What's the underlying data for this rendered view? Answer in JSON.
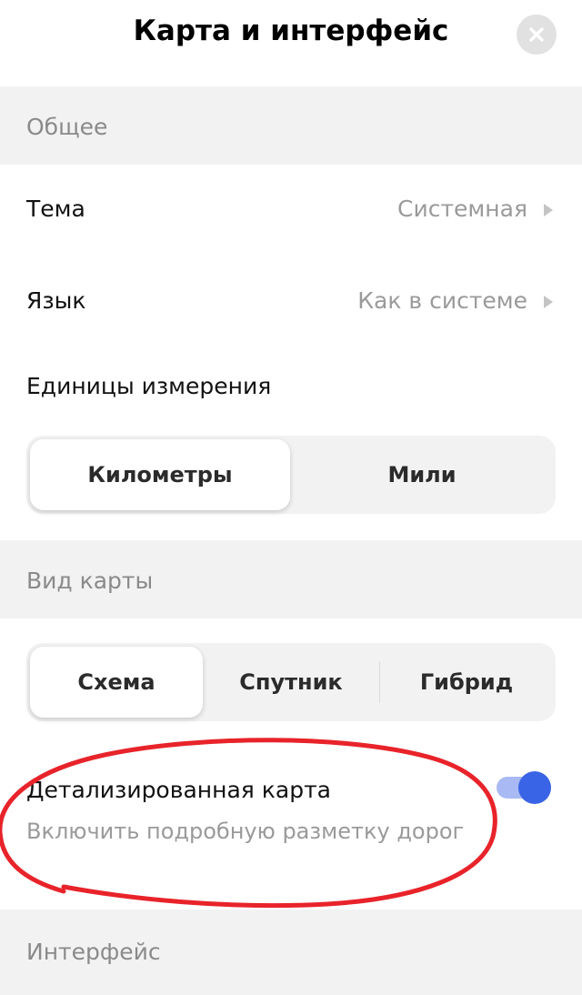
{
  "header": {
    "title": "Карта и интерфейс"
  },
  "sections": {
    "general": {
      "title": "Общее",
      "theme": {
        "label": "Тема",
        "value": "Системная"
      },
      "language": {
        "label": "Язык",
        "value": "Как в системе"
      },
      "units": {
        "label": "Единицы измерения",
        "options": [
          "Километры",
          "Мили"
        ],
        "selected": "Километры"
      }
    },
    "map_view": {
      "title": "Вид карты",
      "options": [
        "Схема",
        "Спутник",
        "Гибрид"
      ],
      "selected": "Схема",
      "detailed_map": {
        "label": "Детализированная карта",
        "description": "Включить подробную разметку дорог",
        "enabled": true
      }
    },
    "interface": {
      "title": "Интерфейс"
    }
  },
  "colors": {
    "toggle_on": "#3a64e6",
    "toggle_track_on": "#a9b9f3",
    "annotation": "#e8232a",
    "section_bg": "#f2f2f2"
  },
  "icons": {
    "close": "close-icon",
    "chevron": "chevron-right-icon"
  }
}
